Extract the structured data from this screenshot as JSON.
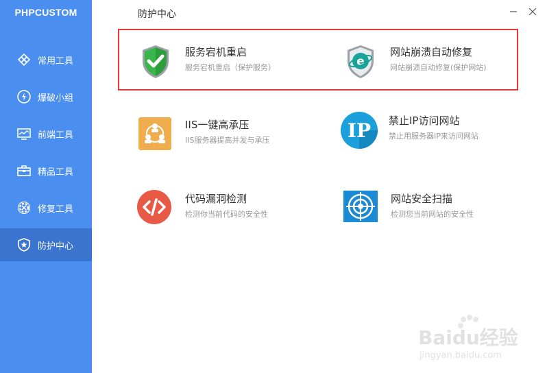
{
  "app": {
    "brand": "PHPCUSTOM",
    "page_title": "防护中心"
  },
  "sidebar": {
    "items": [
      {
        "label": "常用工具",
        "icon": "puzzle-icon"
      },
      {
        "label": "爆破小组",
        "icon": "lightning-icon"
      },
      {
        "label": "前端工具",
        "icon": "monitor-icon"
      },
      {
        "label": "精品工具",
        "icon": "toolbox-icon"
      },
      {
        "label": "修复工具",
        "icon": "gear-wrench-icon"
      },
      {
        "label": "防护中心",
        "icon": "shield-star-icon",
        "active": true
      }
    ]
  },
  "tools": [
    {
      "title": "服务宕机重启",
      "desc": "服务宕机重启（保护服务）",
      "icon": "green-shield-check-icon"
    },
    {
      "title": "网站崩溃自动修复",
      "desc": "网站崩溃自动修复(保护网站)",
      "icon": "ie-shield-icon"
    },
    {
      "title": "IIS一键高承压",
      "desc": "IIS服务器提高并发与承压",
      "icon": "users-network-icon"
    },
    {
      "title": "禁止IP访问网站",
      "desc": "禁止用服务器IP来访问网站",
      "icon": "ip-circle-icon"
    },
    {
      "title": "代码漏洞检测",
      "desc": "检测你当前代码的安全性",
      "icon": "code-brackets-icon"
    },
    {
      "title": "网站安全扫描",
      "desc": "检测您当前网站的安全性",
      "icon": "target-scan-icon"
    }
  ],
  "window": {
    "minimize_icon": "minimize-icon",
    "close_icon": "close-icon"
  },
  "watermark": {
    "text": "Baidu经验",
    "sub": "jingyan.baidu.com"
  },
  "colors": {
    "sidebar": "#4a8ef0",
    "sidebar_active": "#3a74cf",
    "highlight": "#e53935"
  }
}
